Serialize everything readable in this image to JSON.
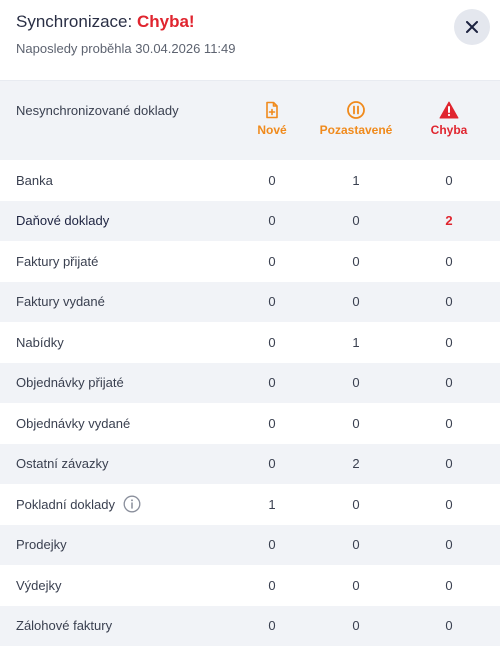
{
  "header": {
    "title": "Synchronizace:",
    "status": "Chyba!",
    "subtitle": "Naposledy proběhla 30.04.2026 11:49",
    "close_icon": "close-icon"
  },
  "table": {
    "label": "Nesynchronizované doklady",
    "columns": [
      {
        "label": "Nové",
        "icon": "new-document-icon",
        "color": "#f08a1c"
      },
      {
        "label": "Pozastavené",
        "icon": "pause-circle-icon",
        "color": "#f08a1c"
      },
      {
        "label": "Chyba",
        "icon": "warning-triangle-icon",
        "color": "#e0252f"
      }
    ],
    "rows": [
      {
        "name": "Banka",
        "values": [
          "0",
          "1",
          "0"
        ]
      },
      {
        "name": "Daňové doklady",
        "values": [
          "0",
          "0",
          "2"
        ],
        "error": true
      },
      {
        "name": "Faktury přijaté",
        "values": [
          "0",
          "0",
          "0"
        ]
      },
      {
        "name": "Faktury vydané",
        "values": [
          "0",
          "0",
          "0"
        ]
      },
      {
        "name": "Nabídky",
        "values": [
          "0",
          "1",
          "0"
        ]
      },
      {
        "name": "Objednávky přijaté",
        "values": [
          "0",
          "0",
          "0"
        ]
      },
      {
        "name": "Objednávky vydané",
        "values": [
          "0",
          "0",
          "0"
        ]
      },
      {
        "name": "Ostatní závazky",
        "values": [
          "0",
          "2",
          "0"
        ]
      },
      {
        "name": "Pokladní doklady",
        "values": [
          "1",
          "0",
          "0"
        ],
        "info_icon": "info-icon"
      },
      {
        "name": "Prodejky",
        "values": [
          "0",
          "0",
          "0"
        ]
      },
      {
        "name": "Výdejky",
        "values": [
          "0",
          "0",
          "0"
        ]
      },
      {
        "name": "Zálohové faktury",
        "values": [
          "0",
          "0",
          "0"
        ]
      }
    ]
  }
}
